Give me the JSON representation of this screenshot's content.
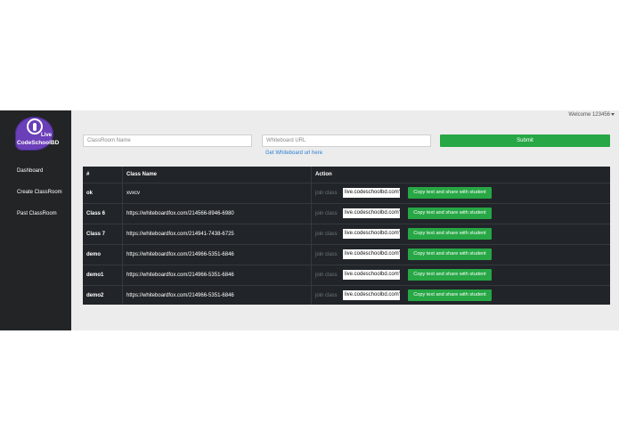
{
  "brand": {
    "logo_word": "CodeSchoolBD",
    "logo_live": "Live"
  },
  "sidebar": {
    "items": [
      {
        "label": "Dashboard"
      },
      {
        "label": "Create ClassRoom"
      },
      {
        "label": "Past ClassRoom"
      }
    ]
  },
  "header": {
    "welcome": "Welcome 123456"
  },
  "form": {
    "classroom_placeholder": "ClassRoom Name",
    "whiteboard_placeholder": "Whiteboard URL",
    "submit_label": "Submit",
    "whiteboard_link": "Get Whiteboard url here"
  },
  "table": {
    "headers": [
      "#",
      "Class Name",
      "Action"
    ],
    "join_label": "join class",
    "copy_label": "Copy text and share with student",
    "rows": [
      {
        "id": "ok",
        "name": "xvxcv",
        "url": "live.codeschoolbd.com?c"
      },
      {
        "id": "Class 6",
        "name": "https://whiteboardfox.com/214566-8946-6980",
        "url": "live.codeschoolbd.com?c"
      },
      {
        "id": "Class 7",
        "name": "https://whiteboardfox.com/214941-7438-6725",
        "url": "live.codeschoolbd.com?c"
      },
      {
        "id": "demo",
        "name": "https://whiteboardfox.com/214966-5351-6846",
        "url": "live.codeschoolbd.com?c"
      },
      {
        "id": "demo1",
        "name": "https://whiteboardfox.com/214966-5351-6846",
        "url": "live.codeschoolbd.com?c"
      },
      {
        "id": "demo2",
        "name": "https://whiteboardfox.com/214966-5351-6846",
        "url": "live.codeschoolbd.com?c"
      }
    ]
  },
  "colors": {
    "sidebar": "#222426",
    "accent": "#27a745",
    "table": "#212529",
    "link": "#2a7fd4",
    "logo": "#6a3fb8"
  }
}
